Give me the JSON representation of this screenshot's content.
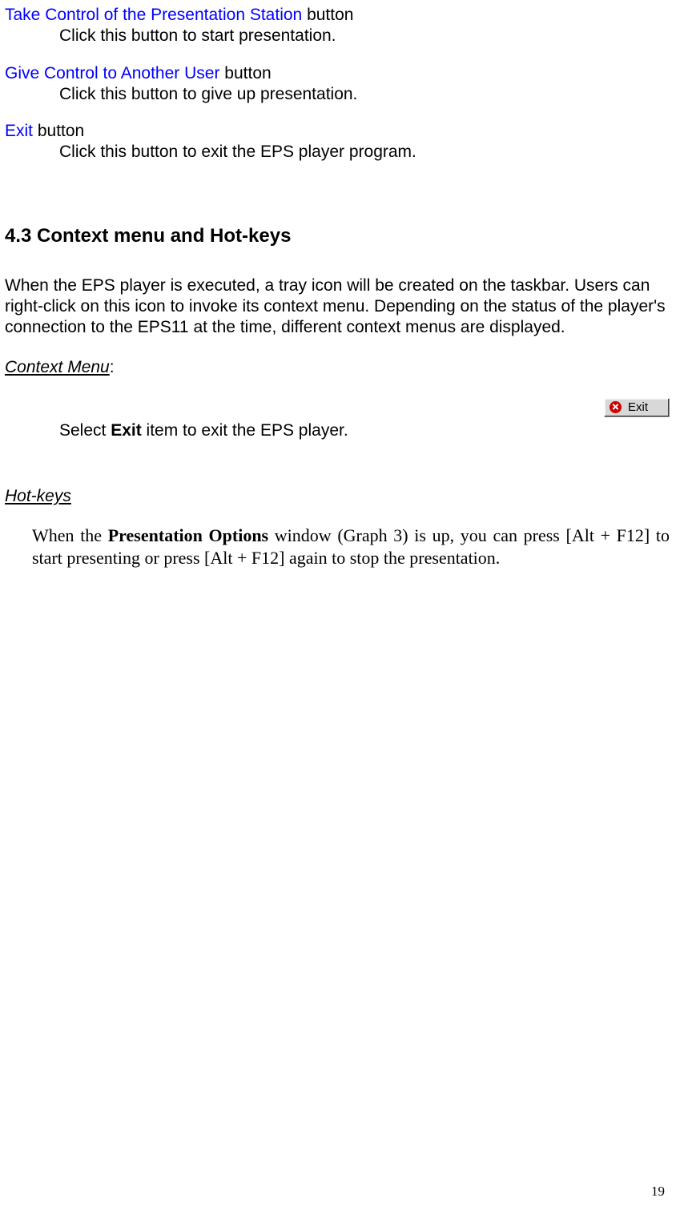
{
  "items": [
    {
      "title_blue": "Take Control of the Presentation Station",
      "title_suffix": " button",
      "desc": "Click this button to start presentation."
    },
    {
      "title_blue": "Give Control to Another User",
      "title_suffix": " button",
      "desc": "Click this button to give up presentation."
    },
    {
      "title_blue": "Exit",
      "title_suffix": " button",
      "desc": "Click this button to exit the EPS player program."
    }
  ],
  "section_heading": "4.3 Context menu and Hot-keys",
  "section_para": "When the EPS player is executed, a tray icon will be created on the taskbar.  Users can right-click on this icon to invoke its context menu.  Depending on the status of the player's connection to the EPS11 at the time, different context menus are displayed.",
  "context_menu_label": "Context Menu",
  "context_menu_colon": ":",
  "select_pre": "Select ",
  "select_bold": "Exit",
  "select_post": " item to exit the EPS player.",
  "exit_button_graphic_label": "Exit",
  "hotkeys_label": "Hot-keys",
  "hotkeys_pre": "When the ",
  "hotkeys_bold": "Presentation Options",
  "hotkeys_post": " window (Graph 3) is up, you can press [Alt + F12] to start presenting or press [Alt + F12] again to stop the presentation.",
  "page_number": "19"
}
